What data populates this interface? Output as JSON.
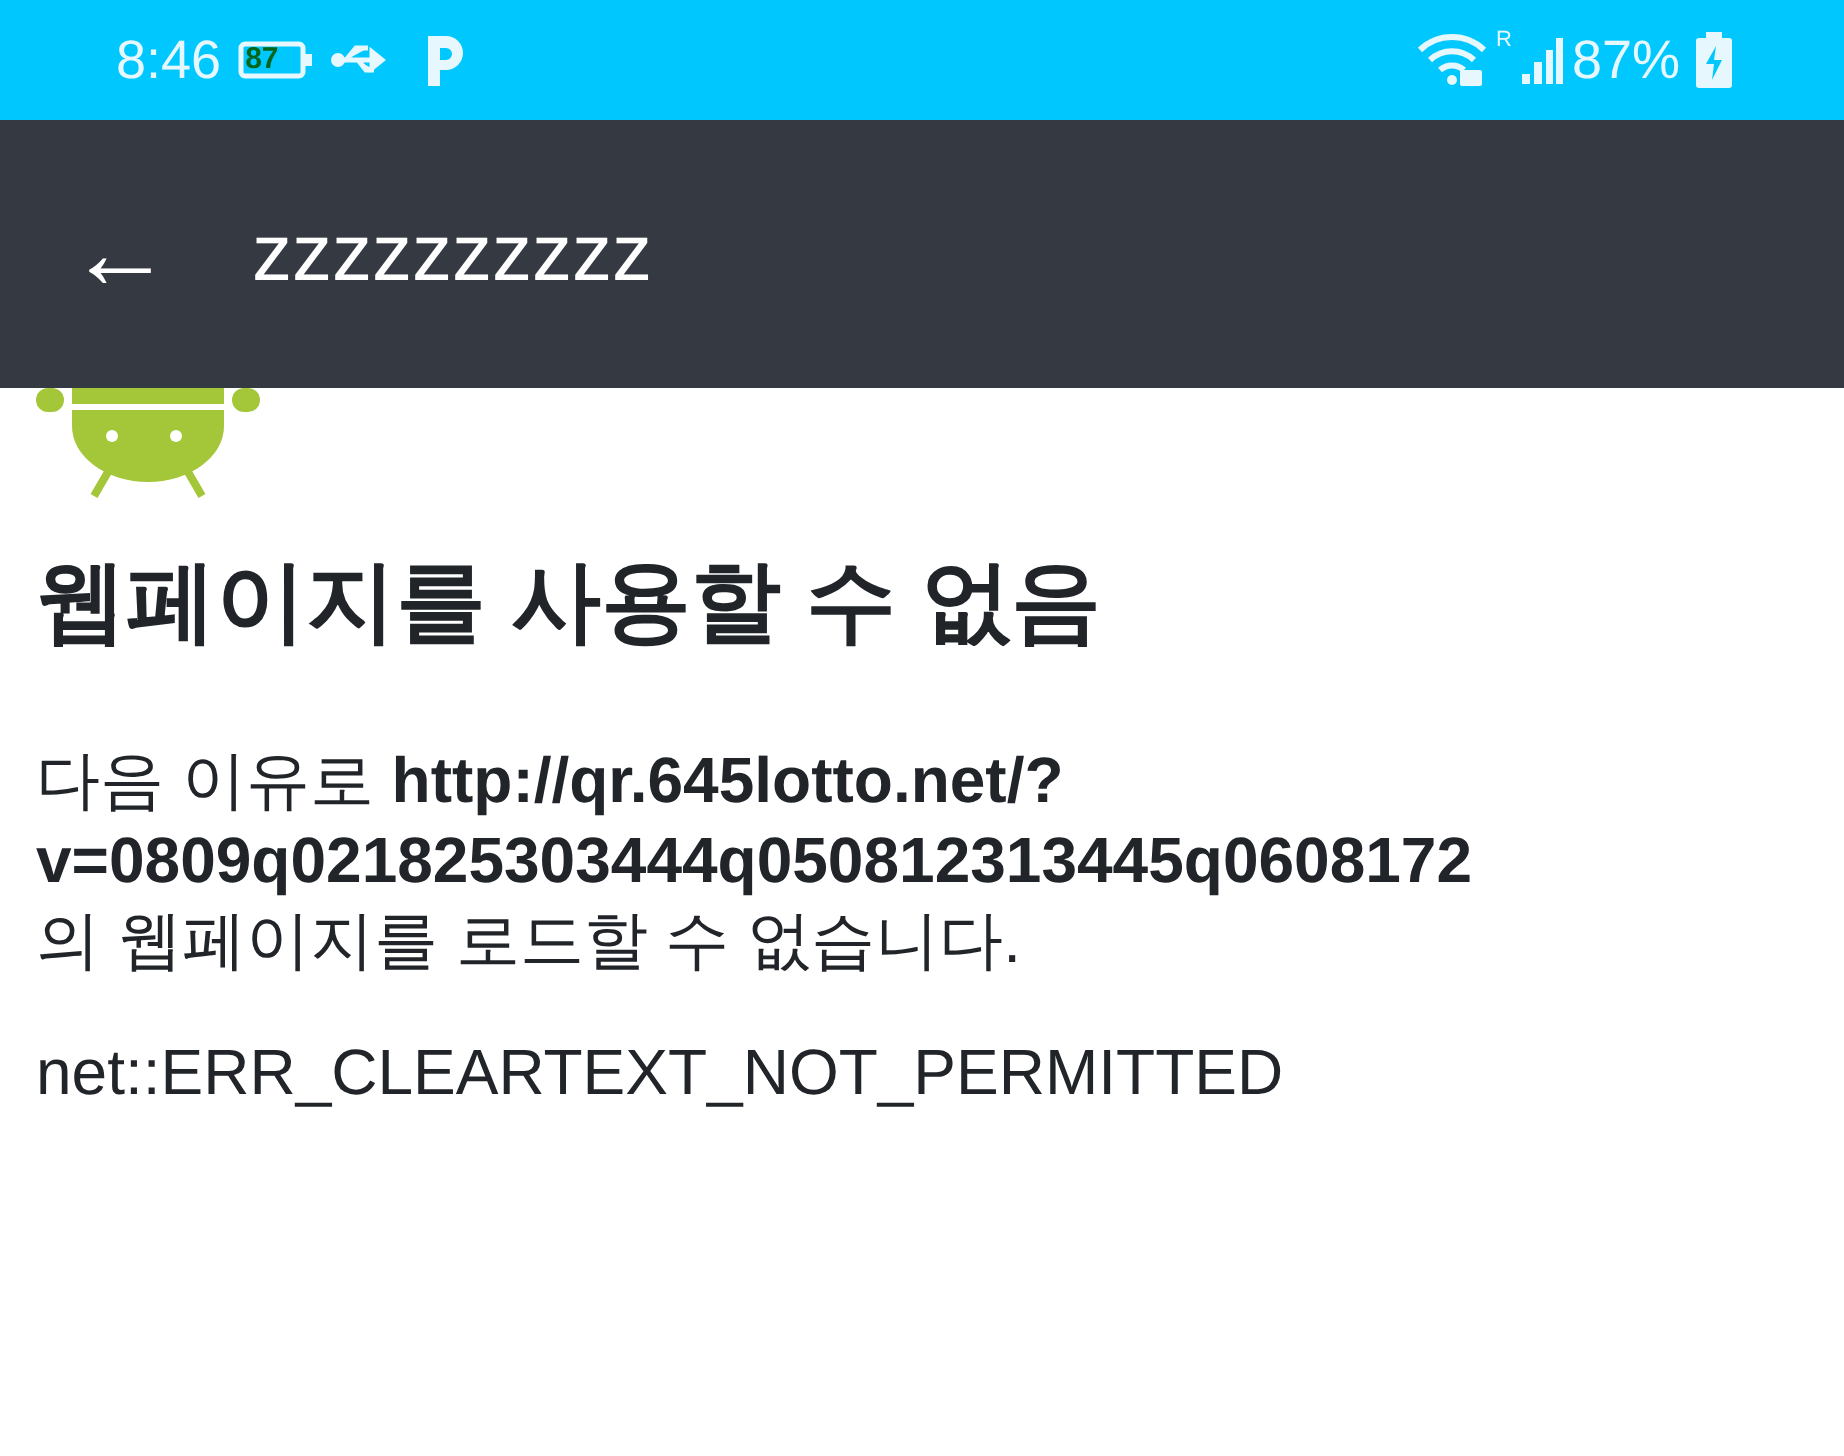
{
  "status_bar": {
    "time": "8:46",
    "battery_badge": "87",
    "battery_percent": "87%",
    "roaming_mark": "R"
  },
  "app_bar": {
    "back": "←",
    "title": "zzzzzzzzzz"
  },
  "error_page": {
    "kind": "picture",
    "heading": "웹페이지를 사용할 수 없음",
    "message": "다음 이유로 **http://qr.645lotto.net/?**\n**v=0809q021825303444q050812313445q0608172**\n의 웹페이지를 로드할 수 없습니다.",
    "error_code": "net::ERR_CLEARTEXT_NOT_PERMITTED"
  }
}
